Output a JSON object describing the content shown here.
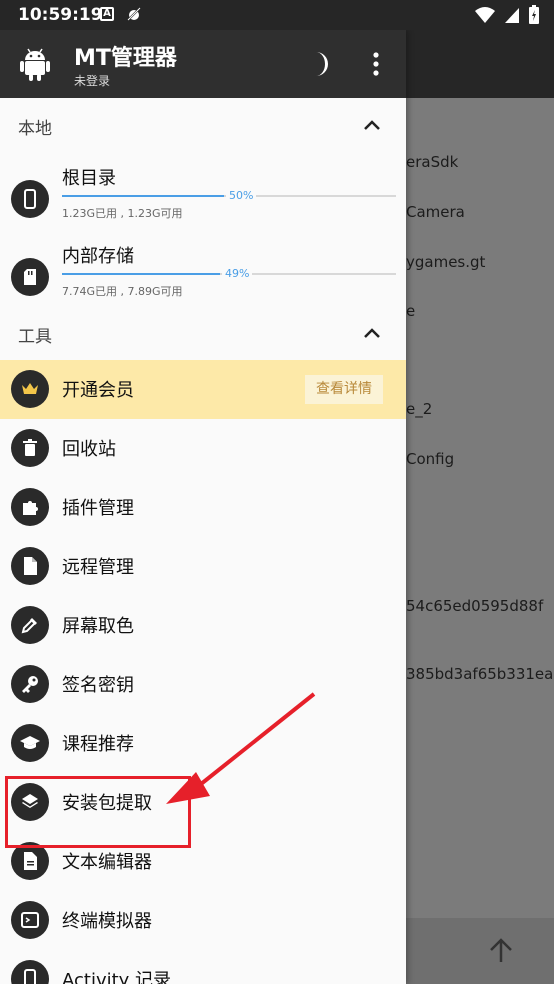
{
  "status_bar": {
    "time": "10:59:19",
    "notif_a": "A"
  },
  "header": {
    "title": "MT管理器",
    "subtitle": "未登录"
  },
  "sections": {
    "local": "本地",
    "tools": "工具"
  },
  "storages": [
    {
      "name": "根目录",
      "percent_label": "50%",
      "percent": 50,
      "usage": "1.23G已用 , 1.23G可用"
    },
    {
      "name": "内部存储",
      "percent_label": "49%",
      "percent": 49,
      "usage": "7.74G已用 , 7.89G可用"
    }
  ],
  "tools": [
    {
      "label": "开通会员",
      "action": "查看详情",
      "icon": "crown-icon"
    },
    {
      "label": "回收站",
      "icon": "trash-icon"
    },
    {
      "label": "插件管理",
      "icon": "puzzle-icon"
    },
    {
      "label": "远程管理",
      "icon": "file-icon"
    },
    {
      "label": "屏幕取色",
      "icon": "eyedropper-icon"
    },
    {
      "label": "签名密钥",
      "icon": "key-icon"
    },
    {
      "label": "课程推荐",
      "icon": "graduation-cap-icon"
    },
    {
      "label": "安装包提取",
      "icon": "layers-icon"
    },
    {
      "label": "文本编辑器",
      "icon": "document-icon"
    },
    {
      "label": "终端模拟器",
      "icon": "terminal-icon"
    },
    {
      "label": "Activity 记录",
      "icon": "phone-icon"
    }
  ],
  "background_list": [
    "eraSdk",
    "Camera",
    "ygames.gt",
    "e",
    "e_2",
    "Config",
    "54c65ed0595d88f",
    "385bd3af65b331ea"
  ],
  "colors": {
    "accent": "#4a9ee6",
    "vip_bg": "#fde9a8",
    "annotation": "#e6202a",
    "header_bg": "#2f2f2f"
  }
}
